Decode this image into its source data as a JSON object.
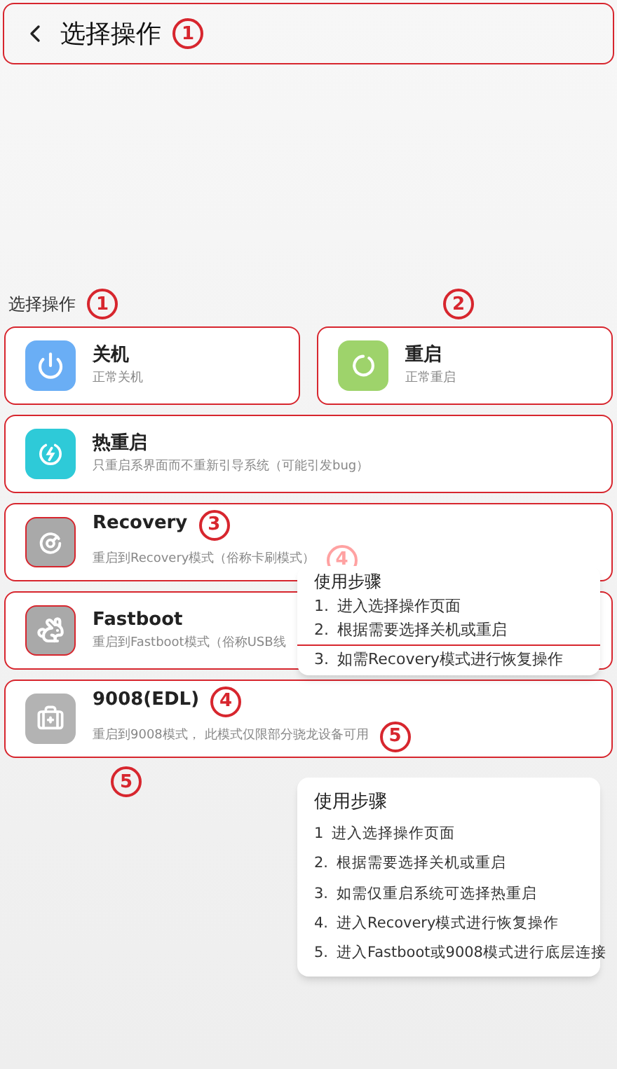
{
  "header": {
    "title": "选择操作",
    "marker": "1"
  },
  "section": {
    "label": "选择操作",
    "markers": [
      "1",
      "2"
    ]
  },
  "top_actions": [
    {
      "kind": "power",
      "title": "关机",
      "subtitle": "正常关机",
      "color": "#6aaef5",
      "icon_outlined": false
    },
    {
      "kind": "restart",
      "title": "重启",
      "subtitle": "正常重启",
      "color": "#9ed36b",
      "icon_outlined": false
    }
  ],
  "actions": [
    {
      "kind": "bolt",
      "title": "热重启",
      "subtitle": "只重启系界面而不重新引导系统（可能引发bug）",
      "color": "#2ecad8",
      "icon_outlined": false
    },
    {
      "kind": "recovery",
      "title": "Recovery",
      "subtitle": "重启到Recovery模式（俗称卡刷模式）",
      "color": "#a9a9a9",
      "icon_outlined": true,
      "title_marker": "3",
      "faded_marker": "4"
    },
    {
      "kind": "rabbit",
      "title": "Fastboot",
      "subtitle": "重启到Fastboot模式（俗称USB线",
      "color": "#a9a9a9",
      "icon_outlined": true
    },
    {
      "kind": "kit",
      "title": "9008(EDL)",
      "subtitle": "重启到9008模式， 此模式仅限部分骁龙设备可用",
      "color": "#b3b3b3",
      "icon_outlined": false,
      "title_marker": "4",
      "sub_marker": "5"
    }
  ],
  "footer_marker": "5",
  "popups": [
    {
      "title": "使用步骤",
      "steps": [
        {
          "kind": "step",
          "number": "1.",
          "text": "进入选择操作页面"
        },
        {
          "kind": "step",
          "number": "2.",
          "text": "根据需要选择关机或重启"
        },
        {
          "kind": "divider"
        },
        {
          "kind": "step",
          "number": "3.",
          "text": "如需Recovery模式进行恢复操作"
        }
      ]
    },
    {
      "title": "使用步骤",
      "steps": [
        {
          "kind": "step",
          "number": "1",
          "text": "进入选择操作页面"
        },
        {
          "kind": "step",
          "number": "2.",
          "text": "根据需要选择关机或重启"
        },
        {
          "kind": "step",
          "number": "3.",
          "text": "如需仅重启系统可选择热重启"
        },
        {
          "kind": "step",
          "number": "4.",
          "text": "进入Recovery模式进行恢复操作"
        },
        {
          "kind": "step",
          "number": "5.",
          "text": "进入Fastboot或9008模式进行底层连接"
        }
      ]
    }
  ]
}
